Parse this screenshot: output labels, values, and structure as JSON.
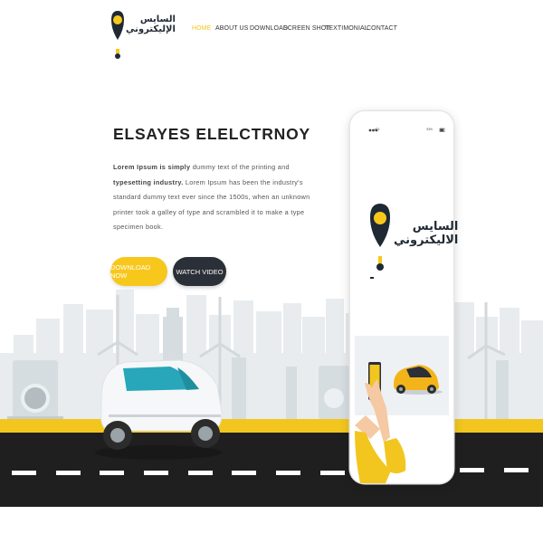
{
  "brand": {
    "name_ar": "السايس\nالإليكتروني"
  },
  "nav": {
    "items": [
      {
        "label": "HOME",
        "active": true
      },
      {
        "label": "ABOUT US"
      },
      {
        "label": "DOWNLOAD"
      },
      {
        "label": "SCREEN SHOT"
      },
      {
        "label": "TEXTIMONIAL"
      },
      {
        "label": "CONTACT"
      }
    ]
  },
  "hero": {
    "title": "ELSAYES ELELCTRNOY",
    "desc_bold_1": "Lorem Ipsum is simply",
    "desc_1": " dummy text of the printing and ",
    "desc_bold_2": "typesetting industry.",
    "desc_2": " Lorem Ipsum has been the industry's standard dummy text ever since the 1500s, when an unknown printer took a galley of type and scrambled it to make a type specimen book."
  },
  "buttons": {
    "download": "DOWNLOAD NOW",
    "watch": "WATCH VIDEO"
  },
  "phone": {
    "carrier": "ATL",
    "battery": "93%",
    "logo_text_ar": "السايس\nالاليكتروني"
  },
  "colors": {
    "accent": "#f7c71c",
    "dark": "#2b2f38",
    "road": "#1f1f1f",
    "city": "#e9ecee",
    "car_window": "#27a7b9"
  }
}
